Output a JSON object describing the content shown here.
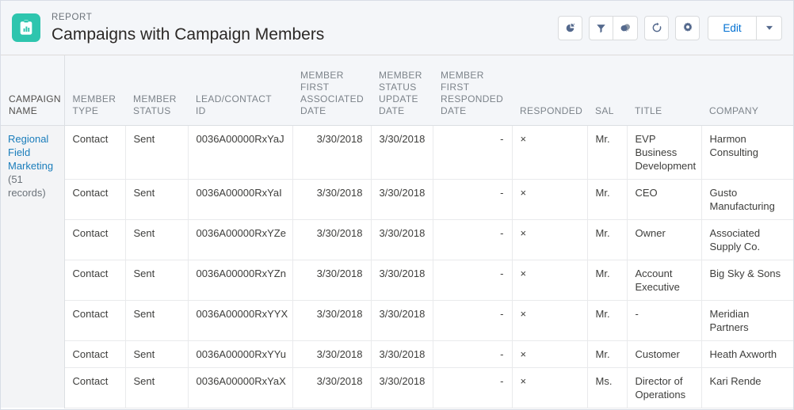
{
  "header": {
    "eyebrow": "REPORT",
    "title": "Campaigns with Campaign Members",
    "icon": "report-clipboard-icon"
  },
  "toolbar": {
    "buttons": [
      {
        "name": "add-chart-button",
        "icon": "pie-chart-icon",
        "label": ""
      },
      {
        "name": "filters-button",
        "icon": "filter-funnel-icon",
        "label": ""
      },
      {
        "name": "feed-button",
        "icon": "feed-bubbles-icon",
        "label": ""
      },
      {
        "name": "refresh-button",
        "icon": "refresh-icon",
        "label": ""
      },
      {
        "name": "settings-button",
        "icon": "gear-icon",
        "label": ""
      }
    ],
    "edit_label": "Edit",
    "edit_caret_icon": "chevron-down-icon",
    "accent_link_color": "#0070d2"
  },
  "table": {
    "columns": [
      "CAMPAIGN NAME",
      "MEMBER TYPE",
      "MEMBER STATUS",
      "LEAD/CONTACT ID",
      "MEMBER FIRST ASSOCIATED DATE",
      "MEMBER STATUS UPDATE DATE",
      "MEMBER FIRST RESPONDED DATE",
      "RESPONDED",
      "SAL",
      "TITLE",
      "COMPANY"
    ],
    "group": {
      "name": "Regional Field Marketing",
      "count": "(51 records)"
    },
    "rows": [
      {
        "member_type": "Contact",
        "member_status": "Sent",
        "lead_contact_id": "0036A00000RxYaJ",
        "first_associated_date": "3/30/2018",
        "status_update_date": "3/30/2018",
        "first_responded_date": "-",
        "responded": "×",
        "sal": "Mr.",
        "title": "EVP Business Development",
        "company": "Harmon Consulting"
      },
      {
        "member_type": "Contact",
        "member_status": "Sent",
        "lead_contact_id": "0036A00000RxYaI",
        "first_associated_date": "3/30/2018",
        "status_update_date": "3/30/2018",
        "first_responded_date": "-",
        "responded": "×",
        "sal": "Mr.",
        "title": "CEO",
        "company": "Gusto Manufacturing"
      },
      {
        "member_type": "Contact",
        "member_status": "Sent",
        "lead_contact_id": "0036A00000RxYZe",
        "first_associated_date": "3/30/2018",
        "status_update_date": "3/30/2018",
        "first_responded_date": "-",
        "responded": "×",
        "sal": "Mr.",
        "title": "Owner",
        "company": "Associated Supply Co."
      },
      {
        "member_type": "Contact",
        "member_status": "Sent",
        "lead_contact_id": "0036A00000RxYZn",
        "first_associated_date": "3/30/2018",
        "status_update_date": "3/30/2018",
        "first_responded_date": "-",
        "responded": "×",
        "sal": "Mr.",
        "title": "Account Executive",
        "company": "Big Sky & Sons"
      },
      {
        "member_type": "Contact",
        "member_status": "Sent",
        "lead_contact_id": "0036A00000RxYYX",
        "first_associated_date": "3/30/2018",
        "status_update_date": "3/30/2018",
        "first_responded_date": "-",
        "responded": "×",
        "sal": "Mr.",
        "title": "-",
        "company": "Meridian Partners"
      },
      {
        "member_type": "Contact",
        "member_status": "Sent",
        "lead_contact_id": "0036A00000RxYYu",
        "first_associated_date": "3/30/2018",
        "status_update_date": "3/30/2018",
        "first_responded_date": "-",
        "responded": "×",
        "sal": "Mr.",
        "title": "Customer",
        "company": "Heath Axworth"
      },
      {
        "member_type": "Contact",
        "member_status": "Sent",
        "lead_contact_id": "0036A00000RxYaX",
        "first_associated_date": "3/30/2018",
        "status_update_date": "3/30/2018",
        "first_responded_date": "-",
        "responded": "×",
        "sal": "Ms.",
        "title": "Director of Operations",
        "company": "Kari Rende"
      }
    ]
  }
}
